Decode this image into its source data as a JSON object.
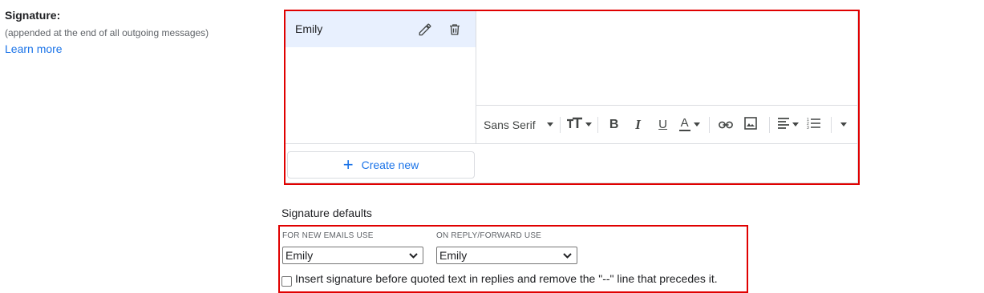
{
  "signature_section": {
    "label": "Signature:",
    "sublabel": "(appended at the end of all outgoing messages)",
    "learn_more": "Learn more"
  },
  "signature_list": {
    "items": [
      {
        "name": "Emily",
        "selected": true
      }
    ],
    "create_new_label": "Create new"
  },
  "editor": {
    "content": "",
    "toolbar": {
      "font_family": "Sans Serif",
      "buttons": [
        "font-size-icon",
        "bold-icon",
        "italic-icon",
        "underline-icon",
        "text-color-icon",
        "link-icon",
        "image-icon",
        "align-icon",
        "numbered-list-icon",
        "more-formatting-icon"
      ]
    }
  },
  "defaults": {
    "title": "Signature defaults",
    "new_emails_label": "FOR NEW EMAILS USE",
    "new_emails_value": "Emily",
    "reply_forward_label": "ON REPLY/FORWARD USE",
    "reply_forward_value": "Emily",
    "insert_before_quoted": "Insert signature before quoted text in replies and remove the \"--\" line that precedes it.",
    "insert_before_quoted_checked": false
  },
  "colors": {
    "accent": "#1a73e8",
    "selected_row": "#e8f0fe",
    "highlight": "#e00000",
    "border": "#dadce0"
  }
}
